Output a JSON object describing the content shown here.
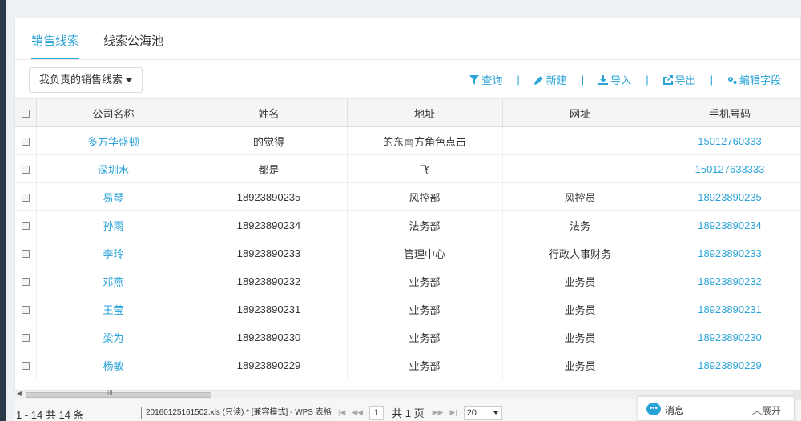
{
  "tabs": [
    {
      "label": "销售线索",
      "active": true
    },
    {
      "label": "线索公海池",
      "active": false
    }
  ],
  "toolbar": {
    "filter_label": "我负责的销售线索",
    "actions": [
      {
        "label": "查询",
        "icon": "filter-icon"
      },
      {
        "label": "新建",
        "icon": "pencil-icon"
      },
      {
        "label": "导入",
        "icon": "download-icon"
      },
      {
        "label": "导出",
        "icon": "export-icon"
      },
      {
        "label": "编辑字段",
        "icon": "gears-icon"
      }
    ],
    "separator": "|"
  },
  "table": {
    "columns": [
      "公司名称",
      "姓名",
      "地址",
      "网址",
      "手机号码"
    ],
    "rows": [
      {
        "company": "多方华盛顿",
        "name": "的觉得",
        "address": "的东南方角色点击",
        "website": "",
        "phone": "15012760333"
      },
      {
        "company": "深圳水",
        "name": "都是",
        "address": "飞",
        "website": "",
        "phone": "150127633333"
      },
      {
        "company": "易琴",
        "name": "18923890235",
        "address": "风控部",
        "website": "风控员",
        "phone": "18923890235"
      },
      {
        "company": "孙雨",
        "name": "18923890234",
        "address": "法务部",
        "website": "法务",
        "phone": "18923890234"
      },
      {
        "company": "李玲",
        "name": "18923890233",
        "address": "管理中心",
        "website": "行政人事财务",
        "phone": "18923890233"
      },
      {
        "company": "邓燕",
        "name": "18923890232",
        "address": "业务部",
        "website": "业务员",
        "phone": "18923890232"
      },
      {
        "company": "王莹",
        "name": "18923890231",
        "address": "业务部",
        "website": "业务员",
        "phone": "18923890231"
      },
      {
        "company": "梁为",
        "name": "18923890230",
        "address": "业务部",
        "website": "业务员",
        "phone": "18923890230"
      },
      {
        "company": "杨敏",
        "name": "18923890229",
        "address": "业务部",
        "website": "业务员",
        "phone": "18923890229"
      }
    ]
  },
  "footer": {
    "count_text": "1 - 14   共 14 条",
    "taskbar_tip": "20160125161502.xls (只读) * [兼容模式] - WPS 表格",
    "page_input": "1",
    "page_total": "共 1 页",
    "page_size": "20",
    "scroll_grip": "III"
  },
  "message": {
    "label": "消息",
    "expand": "︿展开"
  },
  "colors": {
    "accent": "#2aa3d8",
    "sidebar": "#2b3a48"
  }
}
